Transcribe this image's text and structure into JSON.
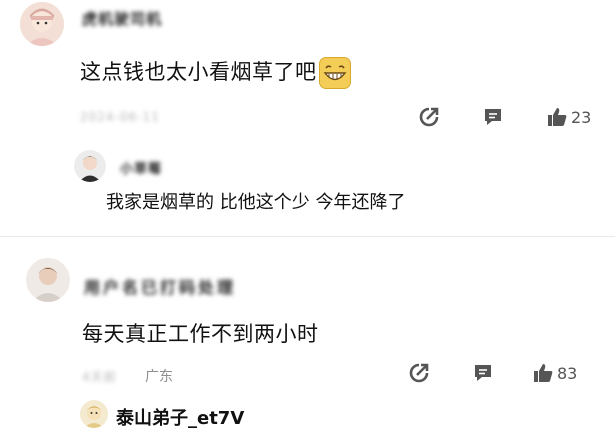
{
  "comment1": {
    "author": "虎机驶司机",
    "text": "这点钱也太小看烟草了吧",
    "emoji": "grin-emoji",
    "meta": "2024-06-11",
    "likes": "23",
    "reply": {
      "author": "小草莓",
      "text": "我家是烟草的 比他这个少 今年还降了"
    }
  },
  "comment2": {
    "author": "用户名已打码处理",
    "text": "每天真正工作不到两小时",
    "meta": "4天前",
    "location": "广东",
    "likes": "83"
  },
  "comment3": {
    "author": "泰山弟子_et7V"
  },
  "colors": {
    "emoji_bg": "#f3cd58",
    "icon": "#555555",
    "text_muted": "#8e8e8e"
  },
  "icons": [
    "share-icon",
    "reply-icon",
    "like-icon"
  ]
}
